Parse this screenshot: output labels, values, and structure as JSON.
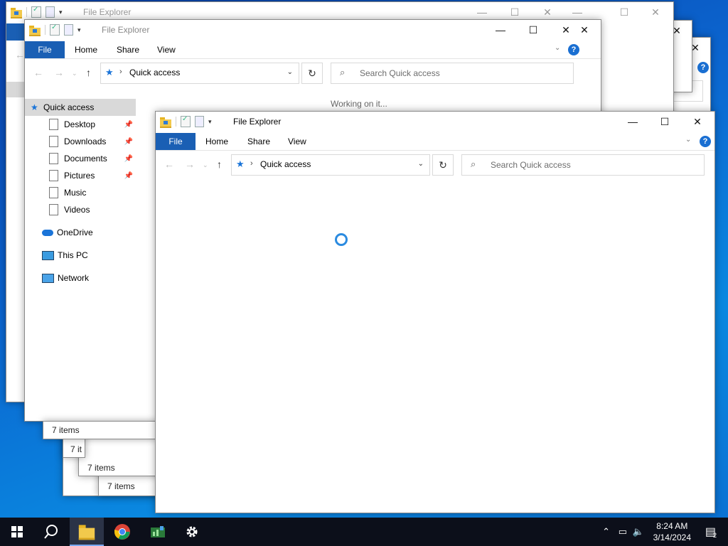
{
  "app": {
    "title": "File Explorer"
  },
  "ribbon": {
    "file": "File",
    "home": "Home",
    "share": "Share",
    "view": "View",
    "help": "?"
  },
  "address": {
    "location": "Quick access"
  },
  "search": {
    "placeholder": "Search Quick access"
  },
  "window2": {
    "loading_text": "Working on it..."
  },
  "nav_pane": {
    "quick_access": "Quick access",
    "items": [
      "Desktop",
      "Downloads",
      "Documents",
      "Pictures",
      "Music",
      "Videos"
    ],
    "onedrive": "OneDrive",
    "thispc": "This PC",
    "network": "Network"
  },
  "status": {
    "count": "7 items",
    "count_short": "7 it"
  },
  "taskbar": {
    "time": "8:24 AM",
    "date": "3/14/2024",
    "notif_count": "2"
  },
  "icons": {
    "start": "windows-logo-icon",
    "search": "search-icon",
    "explorer": "folder-icon",
    "chrome": "chrome-icon",
    "app": "chart-app-icon",
    "settings": "gear-icon"
  },
  "colors": {
    "accent": "#1a5fb4",
    "help": "#1a6fd2"
  }
}
